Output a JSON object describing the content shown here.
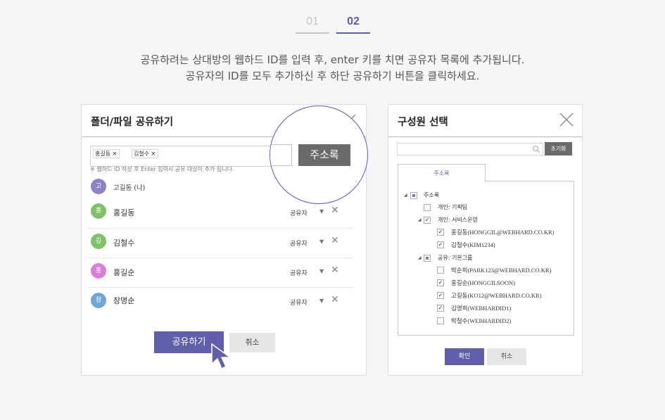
{
  "steps": [
    "01",
    "02"
  ],
  "description": [
    "공유하려는 상대방의 웹하드 ID를 입력 후, enter 키를 치면 공유자 목록에 추가됩니다.",
    "공유자의 ID를 모두 추가하신 후 하단 공유하기 버튼을 클릭하세요."
  ],
  "share_dialog": {
    "title": "폴더/파일 공유하기",
    "tags": [
      "홍길동",
      "김철수"
    ],
    "tag_remove": "×",
    "hint": "※ 웹하드 ID 작성 후 Enter 입력시 공유 대상이 추가 됩니다.",
    "owner": {
      "avatar": "고",
      "name": "고길동 (나)"
    },
    "users": [
      {
        "avatar": "홍",
        "name": "홍길동",
        "role": "공유자"
      },
      {
        "avatar": "김",
        "name": "김철수",
        "role": "공유자"
      },
      {
        "avatar": "홍",
        "name": "홍길순",
        "role": "공유자"
      },
      {
        "avatar": "장",
        "name": "장명순",
        "role": "공유자"
      }
    ],
    "share_button": "공유하기",
    "cancel_button": "취소",
    "address_book_button": "주소록"
  },
  "member_dialog": {
    "title": "구성원 선택",
    "search_placeholder": "",
    "reset_button": "초기화",
    "tab": "주소록",
    "tree": {
      "root": "주소록",
      "g1": "개인: 기획팀",
      "g2": "개인: 서비스운영",
      "g2_items": [
        "홍길동(HONGGIL@WEBHARD.CO.KR)",
        "김철수(KIM1234)"
      ],
      "g3": "공유: 기본그룹",
      "g3_items": [
        "박순희(PARK123@WEBHARD.CO.KR)",
        "홍길순(HONGGILSOON)",
        "고길동(KO12@WEBHARD.CO.KR)",
        "김영희(WEBHARDID1)",
        "박철수(WEBHARDID2)"
      ]
    },
    "ok_button": "확인",
    "cancel_button": "취소"
  },
  "colors": {
    "accent": "#5f5fab",
    "avatar_ko": "#8e82c8",
    "avatar_hong1": "#80c26a",
    "avatar_kim": "#80c26a",
    "avatar_hong2": "#da7ed8",
    "avatar_jang": "#6fa6d9"
  }
}
